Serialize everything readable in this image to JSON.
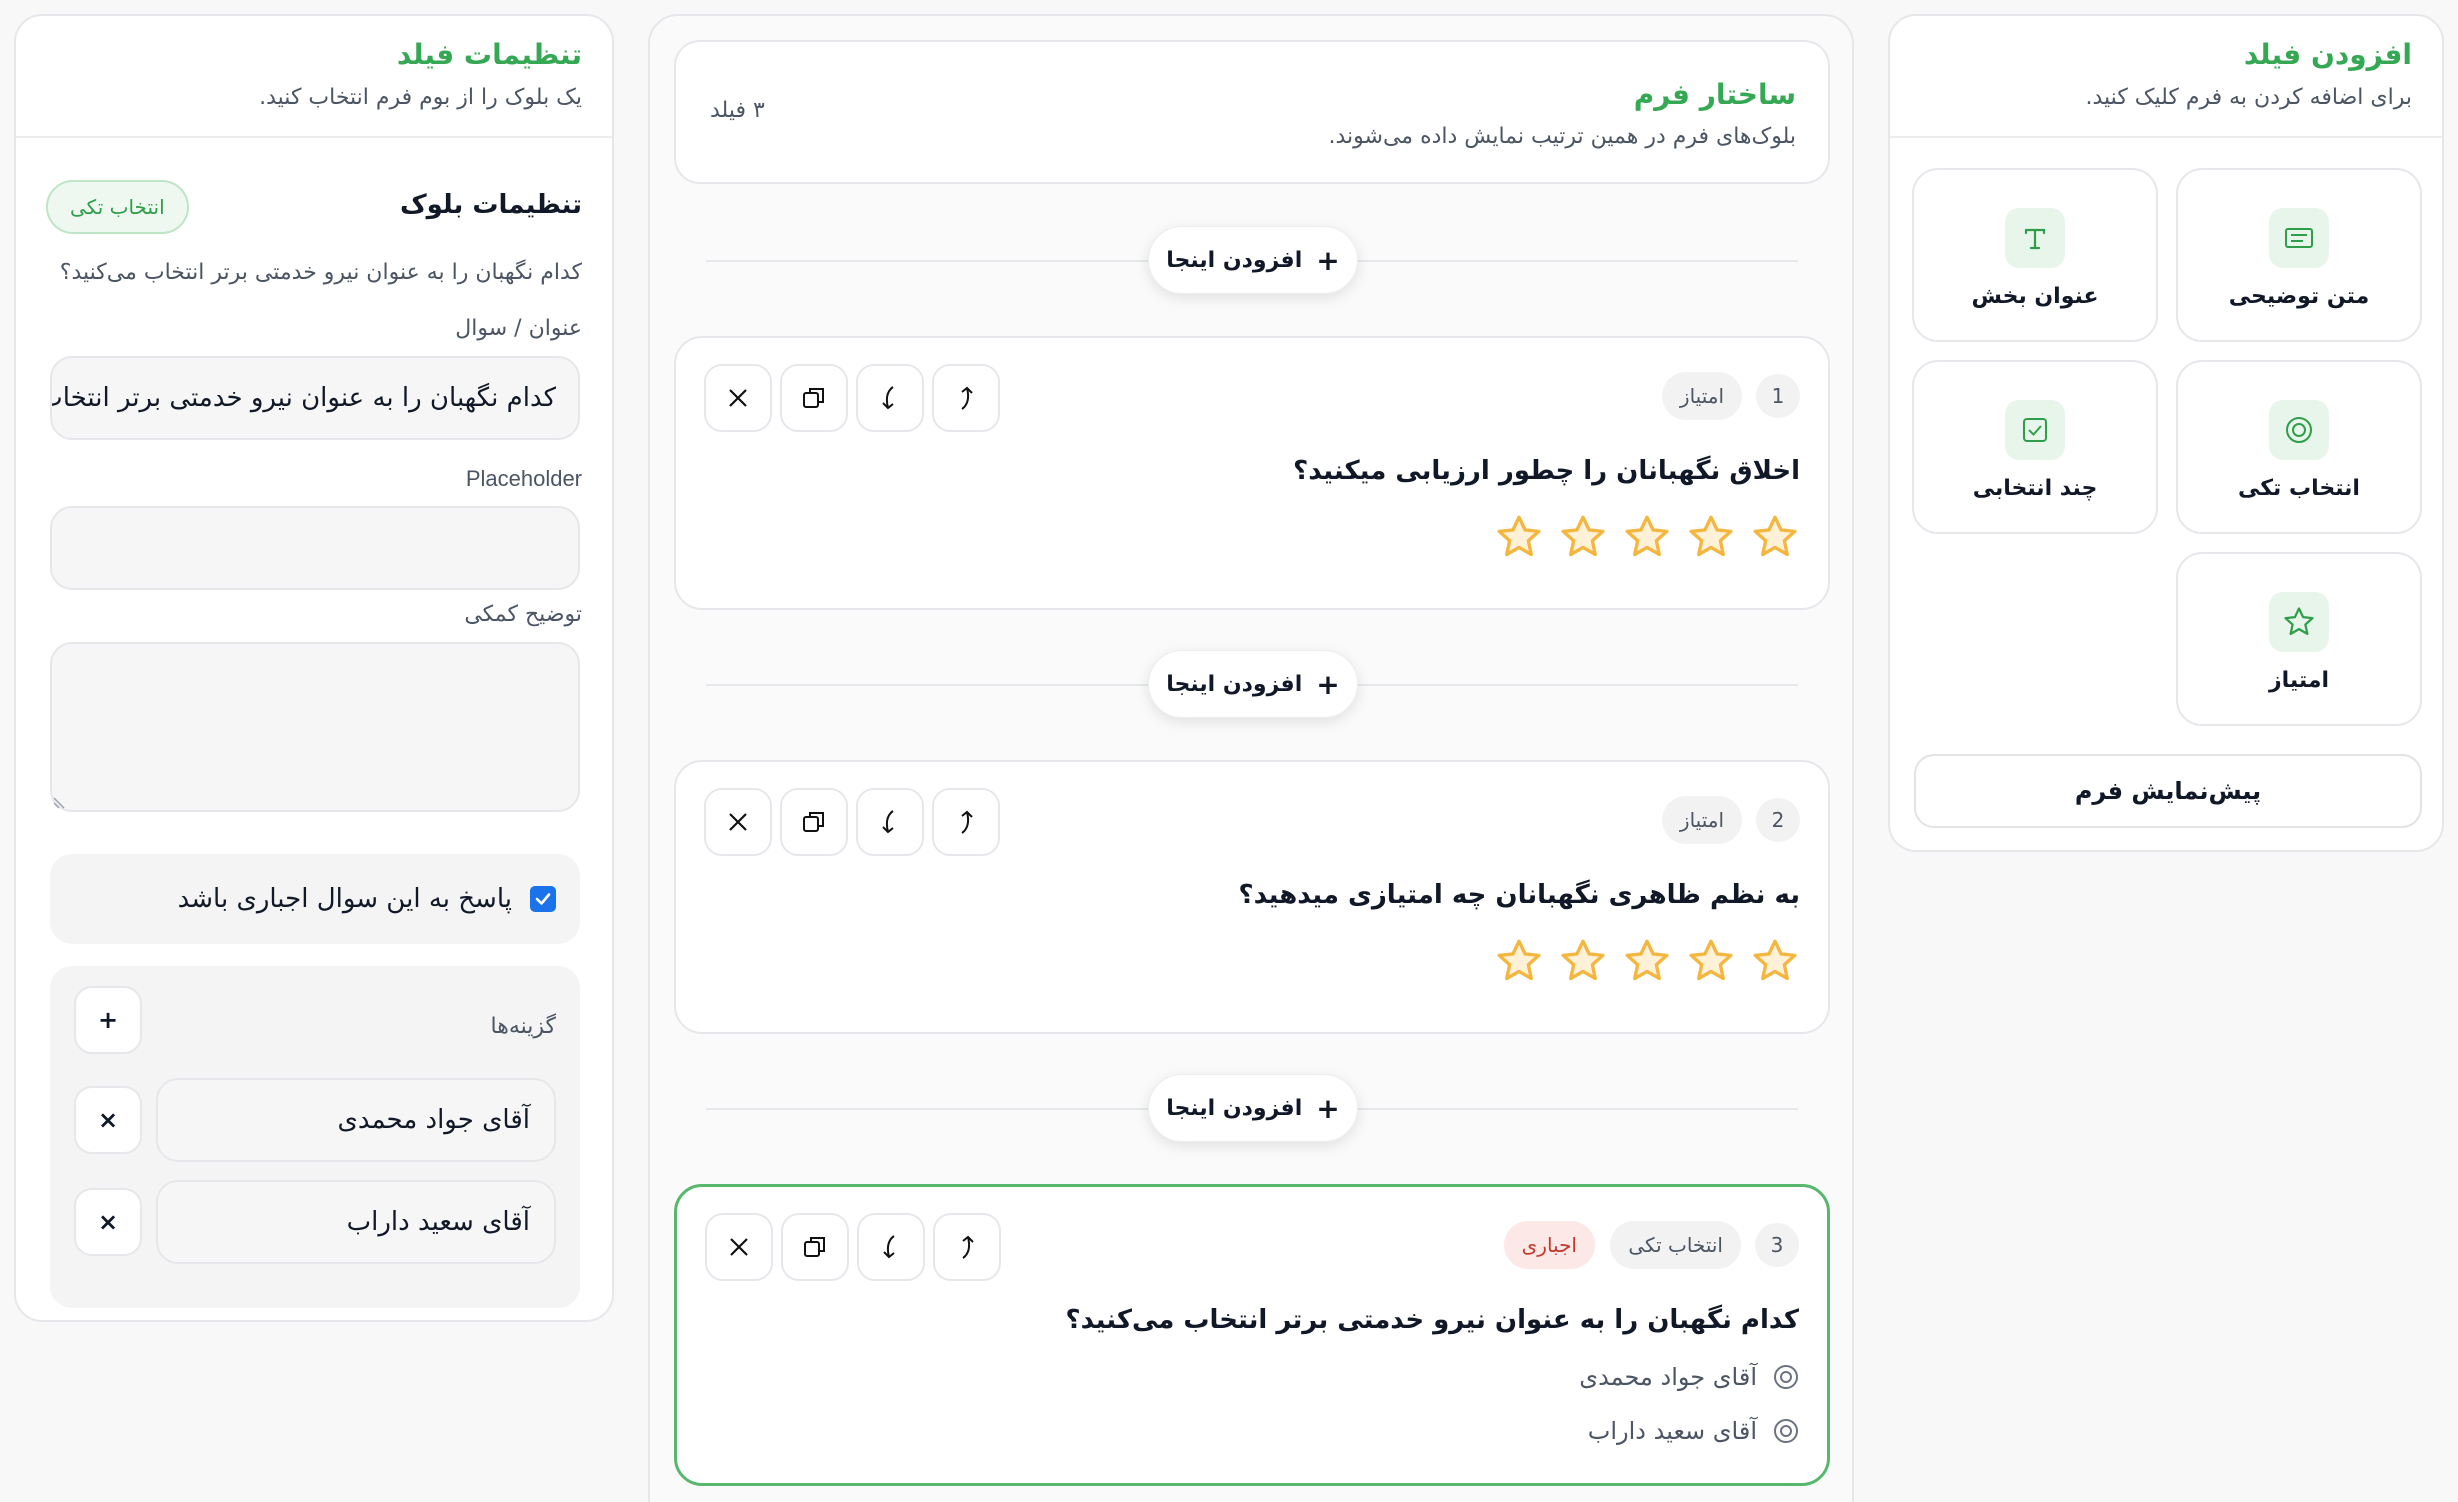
{
  "add_panel": {
    "title": "افزودن فیلد",
    "subtitle": "برای اضافه کردن به فرم کلیک کنید.",
    "tools": [
      {
        "label": "متن توضیحی",
        "icon": "text-block-icon"
      },
      {
        "label": "عنوان بخش",
        "icon": "heading-t-icon"
      },
      {
        "label": "انتخاب تکی",
        "icon": "radio-icon"
      },
      {
        "label": "چند انتخابی",
        "icon": "checkbox-icon"
      },
      {
        "label": "امتیاز",
        "icon": "star-icon"
      }
    ],
    "preview_label": "پیش‌نمایش فرم"
  },
  "settings_panel": {
    "title": "تنظیمات فیلد",
    "subtitle": "یک بلوک را از بوم فرم انتخاب کنید.",
    "block_title": "تنظیمات بلوک",
    "block_type_badge": "انتخاب تکی",
    "block_hint": "کدام نگهبان را به عنوان نیرو خدمتی برتر انتخاب می‌کنید؟",
    "label_question": "عنوان / سوال",
    "question_value": "کدام نگهبان را به عنوان نیرو خدمتی برتر انتخاب می‌کنید؟",
    "label_placeholder": "Placeholder",
    "placeholder_value": "",
    "label_help": "توضیح کمکی",
    "help_value": "",
    "required_label": "پاسخ به این سوال اجباری باشد",
    "required_checked": true,
    "options_title": "گزینه‌ها",
    "add_option": "+",
    "remove_option": "×",
    "options": [
      "آقای جواد محمدی",
      "آقای سعید داراب"
    ]
  },
  "structure": {
    "title": "ساختار فرم",
    "subtitle": "بلوک‌های فرم در همین ترتیب نمایش داده می‌شوند.",
    "count": "۳ فیلد",
    "add_here": "افزودن اینجا",
    "add_here_plus": "+"
  },
  "questions": [
    {
      "num": "1",
      "type": "امتیاز",
      "text": "اخلاق نگهبانان را چطور ارزیابی میکنید؟",
      "rating_max": 5
    },
    {
      "num": "2",
      "type": "امتیاز",
      "text": "به نظم ظاهری نگهبانان چه امتیازی میدهید؟",
      "rating_max": 5
    },
    {
      "num": "3",
      "type": "انتخاب تکی",
      "required_badge": "اجباری",
      "text": "کدام نگهبان را به عنوان نیرو خدمتی برتر انتخاب می‌کنید؟",
      "options": [
        "آقای جواد محمدی",
        "آقای سعید داراب"
      ]
    }
  ],
  "colors": {
    "accent": "#34a853",
    "star": "#f4b63f",
    "required": "#c0392b",
    "checkbox": "#1a73e8"
  }
}
